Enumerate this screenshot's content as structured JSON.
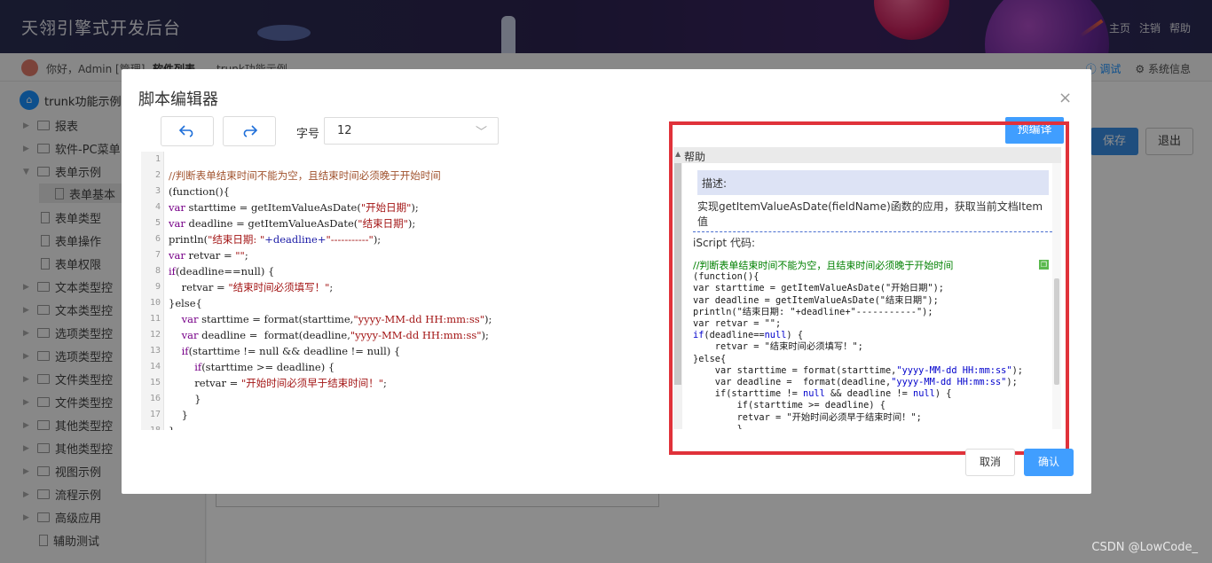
{
  "app": {
    "title": "天翎引擎式开发后台",
    "top_links": [
      "主页",
      "注销",
      "帮助"
    ],
    "greeting": "你好，Admin [管理]",
    "breadcrumb": [
      "软件列表",
      "trunk功能示例"
    ],
    "debug_label": "调试",
    "sysinfo_label": "系统信息",
    "save_label": "保存",
    "exit_label": "退出",
    "watermark": "CSDN @LowCode_"
  },
  "sidebar": {
    "root": "trunk功能示例",
    "items": [
      {
        "label": "报表",
        "type": "folder"
      },
      {
        "label": "软件-PC菜单",
        "type": "folder"
      },
      {
        "label": "表单示例",
        "type": "folder-open"
      },
      {
        "label": "表单基本",
        "type": "doc"
      },
      {
        "label": "表单类型",
        "type": "doc"
      },
      {
        "label": "表单操作",
        "type": "doc"
      },
      {
        "label": "表单权限",
        "type": "doc"
      },
      {
        "label": "文本类型控",
        "type": "folder"
      },
      {
        "label": "文本类型控",
        "type": "folder"
      },
      {
        "label": "选项类型控",
        "type": "folder"
      },
      {
        "label": "选项类型控",
        "type": "folder"
      },
      {
        "label": "文件类型控",
        "type": "folder"
      },
      {
        "label": "文件类型控",
        "type": "folder"
      },
      {
        "label": "其他类型控",
        "type": "folder"
      },
      {
        "label": "其他类型控",
        "type": "folder"
      },
      {
        "label": "视图示例",
        "type": "folder"
      },
      {
        "label": "流程示例",
        "type": "folder"
      },
      {
        "label": "高级应用",
        "type": "folder"
      },
      {
        "label": "辅助测试",
        "type": "doc"
      }
    ]
  },
  "dialog": {
    "title": "脚本编辑器",
    "close": "×",
    "font_size_label": "字号",
    "font_size_value": "12",
    "precompile_label": "预编译",
    "cancel_label": "取消",
    "confirm_label": "确认"
  },
  "editor": {
    "lines": [
      {
        "n": "1",
        "parts": []
      },
      {
        "n": "2",
        "parts": [
          {
            "t": "//判断表单结束时间不能为空，且结束时间必须晚于开始时间",
            "c": "c-comment"
          }
        ]
      },
      {
        "n": "3",
        "parts": [
          {
            "t": "(function(){",
            "c": ""
          }
        ]
      },
      {
        "n": "4",
        "parts": [
          {
            "t": "var ",
            "c": "c-kw"
          },
          {
            "t": "starttime = getItemValueAsDate(",
            "c": ""
          },
          {
            "t": "\"开始日期\"",
            "c": "c-str"
          },
          {
            "t": ");",
            "c": ""
          }
        ]
      },
      {
        "n": "5",
        "parts": [
          {
            "t": "var ",
            "c": "c-kw"
          },
          {
            "t": "deadline = getItemValueAsDate(",
            "c": ""
          },
          {
            "t": "\"结束日期\"",
            "c": "c-str"
          },
          {
            "t": ");",
            "c": ""
          }
        ]
      },
      {
        "n": "6",
        "parts": [
          {
            "t": "println(",
            "c": ""
          },
          {
            "t": "\"结束日期: \"",
            "c": "c-str"
          },
          {
            "t": "+deadline+",
            "c": "c-var"
          },
          {
            "t": "\"-----------\"",
            "c": "c-str"
          },
          {
            "t": ");",
            "c": ""
          }
        ]
      },
      {
        "n": "7",
        "parts": [
          {
            "t": "var ",
            "c": "c-kw"
          },
          {
            "t": "retvar = ",
            "c": ""
          },
          {
            "t": "\"\"",
            "c": "c-str"
          },
          {
            "t": ";",
            "c": ""
          }
        ]
      },
      {
        "n": "8",
        "parts": [
          {
            "t": "if",
            "c": "c-kw"
          },
          {
            "t": "(deadline==null) {",
            "c": ""
          }
        ]
      },
      {
        "n": "9",
        "parts": [
          {
            "t": "    retvar = ",
            "c": ""
          },
          {
            "t": "\"结束时间必须填写！\"",
            "c": "c-str"
          },
          {
            "t": ";",
            "c": ""
          }
        ]
      },
      {
        "n": "10",
        "parts": [
          {
            "t": "}else{",
            "c": ""
          }
        ]
      },
      {
        "n": "11",
        "parts": [
          {
            "t": "    var ",
            "c": "c-kw"
          },
          {
            "t": "starttime = format(starttime,",
            "c": ""
          },
          {
            "t": "\"yyyy-MM-dd HH:mm:ss\"",
            "c": "c-str"
          },
          {
            "t": ");",
            "c": ""
          }
        ]
      },
      {
        "n": "12",
        "parts": [
          {
            "t": "    var ",
            "c": "c-kw"
          },
          {
            "t": "deadline =  format(deadline,",
            "c": ""
          },
          {
            "t": "\"yyyy-MM-dd HH:mm:ss\"",
            "c": "c-str"
          },
          {
            "t": ");",
            "c": ""
          }
        ]
      },
      {
        "n": "13",
        "parts": [
          {
            "t": "    if",
            "c": "c-kw"
          },
          {
            "t": "(starttime != null && deadline != null) {",
            "c": ""
          }
        ]
      },
      {
        "n": "14",
        "parts": [
          {
            "t": "        if",
            "c": "c-kw"
          },
          {
            "t": "(starttime >= deadline) {",
            "c": ""
          }
        ]
      },
      {
        "n": "15",
        "parts": [
          {
            "t": "        retvar = ",
            "c": ""
          },
          {
            "t": "\"开始时间必须早于结束时间！\"",
            "c": "c-str"
          },
          {
            "t": ";",
            "c": ""
          }
        ]
      },
      {
        "n": "16",
        "parts": [
          {
            "t": "        }",
            "c": ""
          }
        ]
      },
      {
        "n": "17",
        "parts": [
          {
            "t": "    }",
            "c": ""
          }
        ]
      },
      {
        "n": "18",
        "parts": [
          {
            "t": "}",
            "c": ""
          }
        ]
      }
    ]
  },
  "help": {
    "header": "帮助",
    "desc_label": "描述:",
    "desc_text": "实现getItemValueAsDate(fieldName)函数的应用，获取当前文档Item值",
    "iscript_label": "iScript 代码:",
    "code": [
      {
        "parts": [
          {
            "t": "//判断表单结束时间不能为空，且结束时间必须晚于开始时间",
            "c": "cm"
          }
        ]
      },
      {
        "parts": [
          {
            "t": "(function(){",
            "c": ""
          }
        ]
      },
      {
        "parts": [
          {
            "t": "var starttime = getItemValueAsDate(",
            "c": ""
          },
          {
            "t": "\"开始日期\"",
            "c": ""
          },
          {
            "t": ");",
            "c": ""
          }
        ]
      },
      {
        "parts": [
          {
            "t": "var deadline = getItemValueAsDate(",
            "c": ""
          },
          {
            "t": "\"结束日期\"",
            "c": ""
          },
          {
            "t": ");",
            "c": ""
          }
        ]
      },
      {
        "parts": [
          {
            "t": "println(\"结束日期: \"+deadline+\"-----------\");",
            "c": ""
          }
        ]
      },
      {
        "parts": [
          {
            "t": "var retvar = \"\";",
            "c": ""
          }
        ]
      },
      {
        "parts": [
          {
            "t": "if",
            "c": "kw"
          },
          {
            "t": "(deadline==",
            "c": ""
          },
          {
            "t": "null",
            "c": "kw"
          },
          {
            "t": ") {",
            "c": ""
          }
        ]
      },
      {
        "parts": [
          {
            "t": "    retvar = \"结束时间必须填写！\";",
            "c": ""
          }
        ]
      },
      {
        "parts": [
          {
            "t": "}else{",
            "c": ""
          }
        ]
      },
      {
        "parts": [
          {
            "t": "    var starttime = format(starttime,",
            "c": ""
          },
          {
            "t": "\"yyyy-MM-dd HH:mm:ss\"",
            "c": "st"
          },
          {
            "t": ");",
            "c": ""
          }
        ]
      },
      {
        "parts": [
          {
            "t": "    var deadline =  format(deadline,",
            "c": ""
          },
          {
            "t": "\"yyyy-MM-dd HH:mm:ss\"",
            "c": "st"
          },
          {
            "t": ");",
            "c": ""
          }
        ]
      },
      {
        "parts": [
          {
            "t": "    if(starttime != ",
            "c": ""
          },
          {
            "t": "null",
            "c": "kw"
          },
          {
            "t": " && deadline != ",
            "c": ""
          },
          {
            "t": "null",
            "c": "kw"
          },
          {
            "t": ") {",
            "c": ""
          }
        ]
      },
      {
        "parts": [
          {
            "t": "        if(starttime >= deadline) {",
            "c": ""
          }
        ]
      },
      {
        "parts": [
          {
            "t": "        retvar = \"开始时间必须早于结束时间！\";",
            "c": ""
          }
        ]
      },
      {
        "parts": [
          {
            "t": "        }",
            "c": ""
          }
        ]
      }
    ]
  },
  "colors": {
    "accent": "#409eff",
    "highlight_frame": "#e0323a"
  }
}
